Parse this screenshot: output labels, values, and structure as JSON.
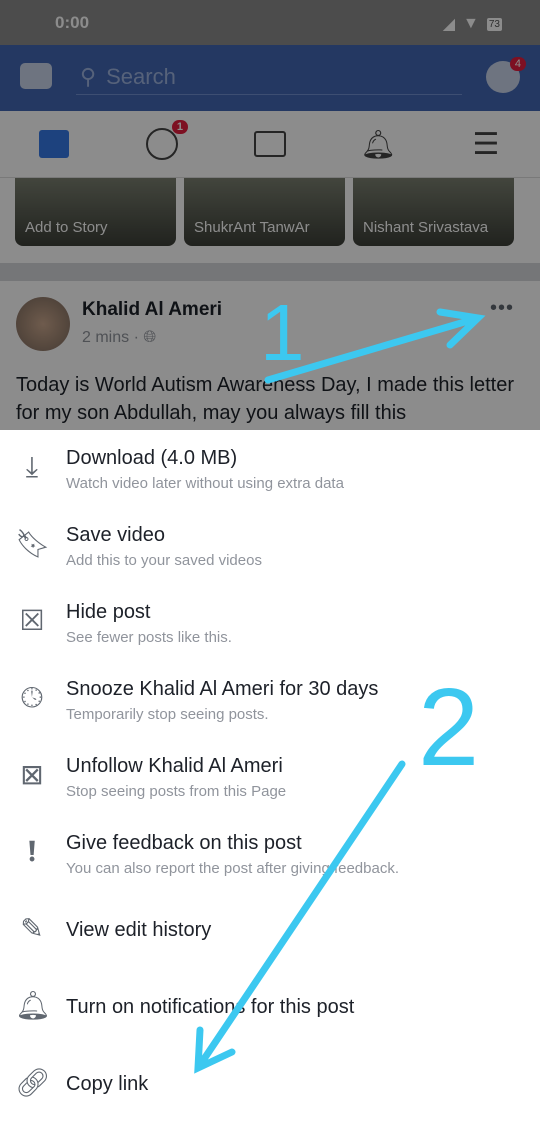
{
  "status": {
    "time": "0:00",
    "battery": "73"
  },
  "header": {
    "search_placeholder": "Search",
    "messenger_badge": "4"
  },
  "nav": {
    "groups_badge": "1"
  },
  "stories": [
    "Add to Story",
    "ShukrAnt TanwAr",
    "Nishant Srivastava"
  ],
  "post": {
    "author": "Khalid Al Ameri",
    "time": "2 mins",
    "more": "•••",
    "text": "Today is World Autism Awareness Day, I made this letter for my son Abdullah, may you always fill this"
  },
  "menu": [
    {
      "icon": "download-icon",
      "title": "Download (4.0 MB)",
      "subtitle": "Watch video later without using extra data"
    },
    {
      "icon": "bookmark-icon",
      "title": "Save video",
      "subtitle": "Add this to your saved videos"
    },
    {
      "icon": "hide-x-icon",
      "title": "Hide post",
      "subtitle": "See fewer posts like this."
    },
    {
      "icon": "clock-icon",
      "title": "Snooze Khalid Al Ameri for 30 days",
      "subtitle": "Temporarily stop seeing posts."
    },
    {
      "icon": "unfollow-icon",
      "title": "Unfollow Khalid Al Ameri",
      "subtitle": "Stop seeing posts from this Page"
    },
    {
      "icon": "feedback-icon",
      "title": "Give feedback on this post",
      "subtitle": "You can also report the post after giving feedback."
    },
    {
      "icon": "edit-history-icon",
      "title": "View edit history",
      "subtitle": ""
    },
    {
      "icon": "bell-icon",
      "title": "Turn on notifications for this post",
      "subtitle": ""
    },
    {
      "icon": "link-icon",
      "title": "Copy link",
      "subtitle": ""
    }
  ],
  "annotations": {
    "step1": "1",
    "step2": "2",
    "color": "#3cc8f0"
  }
}
